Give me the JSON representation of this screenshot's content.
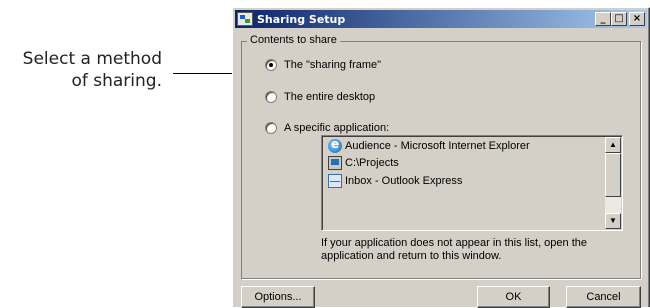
{
  "callout": {
    "line1": "Select a method",
    "line2": "of sharing."
  },
  "window": {
    "title": "Sharing Setup",
    "title_buttons": {
      "minimize": "_",
      "maximize": "□",
      "close": "×"
    }
  },
  "group": {
    "label": "Contents to share",
    "options": [
      {
        "label": "The \"sharing frame\"",
        "checked": true
      },
      {
        "label": "The entire desktop",
        "checked": false
      },
      {
        "label": "A specific application:",
        "checked": false
      }
    ]
  },
  "app_list": {
    "items": [
      {
        "label": "Audience - Microsoft Internet Explorer",
        "icon": "ie-icon"
      },
      {
        "label": "C:\\Projects",
        "icon": "computer-icon"
      },
      {
        "label": "Inbox - Outlook Express",
        "icon": "mail-icon"
      }
    ],
    "scroll_up": "▲",
    "scroll_down": "▼"
  },
  "hint": "If your application does not appear in this list, open the application and return to this window.",
  "buttons": {
    "options": "Options...",
    "ok": "OK",
    "cancel": "Cancel"
  }
}
